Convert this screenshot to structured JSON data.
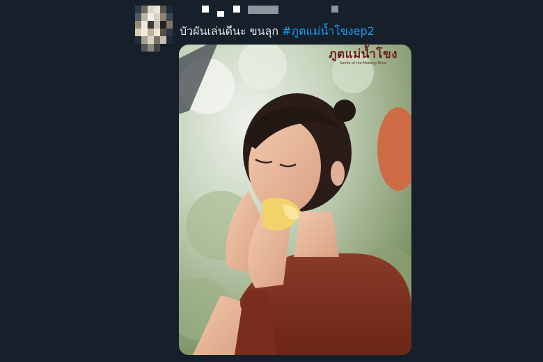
{
  "tweet": {
    "text": "บัวผันเล่นดีนะ ขนลุก ",
    "hashtag": "#ภูตแม่น้ำโขงep2"
  },
  "media": {
    "watermark_title": "ภูตแม่น้ำโขง",
    "watermark_subtitle": "Spirits of the Mekong River"
  },
  "colors": {
    "background": "#15202b",
    "text": "#e7e9ea",
    "hashtag": "#1d9bf0"
  }
}
